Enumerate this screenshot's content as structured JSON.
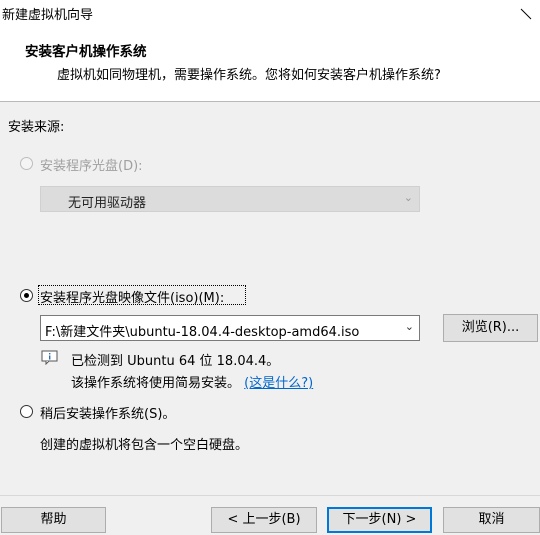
{
  "window": {
    "title": "新建虚拟机向导",
    "close_glyph": "╲"
  },
  "header": {
    "heading": "安装客户机操作系统",
    "subheading": "虚拟机如同物理机，需要操作系统。您将如何安装客户机操作系统?"
  },
  "source": {
    "label": "安装来源:",
    "options": [
      {
        "label": "安装程序光盘(D):",
        "checked": false,
        "enabled": false
      },
      {
        "label": "安装程序光盘映像文件(iso)(M):",
        "checked": true,
        "enabled": true
      },
      {
        "label": "稍后安装操作系统(S)。",
        "checked": false,
        "enabled": true
      }
    ],
    "disc_select": {
      "value": "无可用驱动器"
    },
    "iso_select": {
      "value": "F:\\新建文件夹\\ubuntu-18.04.4-desktop-amd64.iso"
    },
    "browse_label": "浏览(R)...",
    "detected_text": "已检测到 Ubuntu 64 位 18.04.4。",
    "easy_install_text": "该操作系统将使用简易安装。",
    "whats_this_link": "(这是什么?)",
    "blank_disk_text": "创建的虚拟机将包含一个空白硬盘。"
  },
  "footer": {
    "help_label": "帮助",
    "back_label": "< 上一步(B)",
    "next_label": "下一步(N) >",
    "cancel_label": "取消"
  },
  "icons": {
    "info": "info-icon",
    "chevron": "chevron-down-icon",
    "close": "close-icon"
  }
}
